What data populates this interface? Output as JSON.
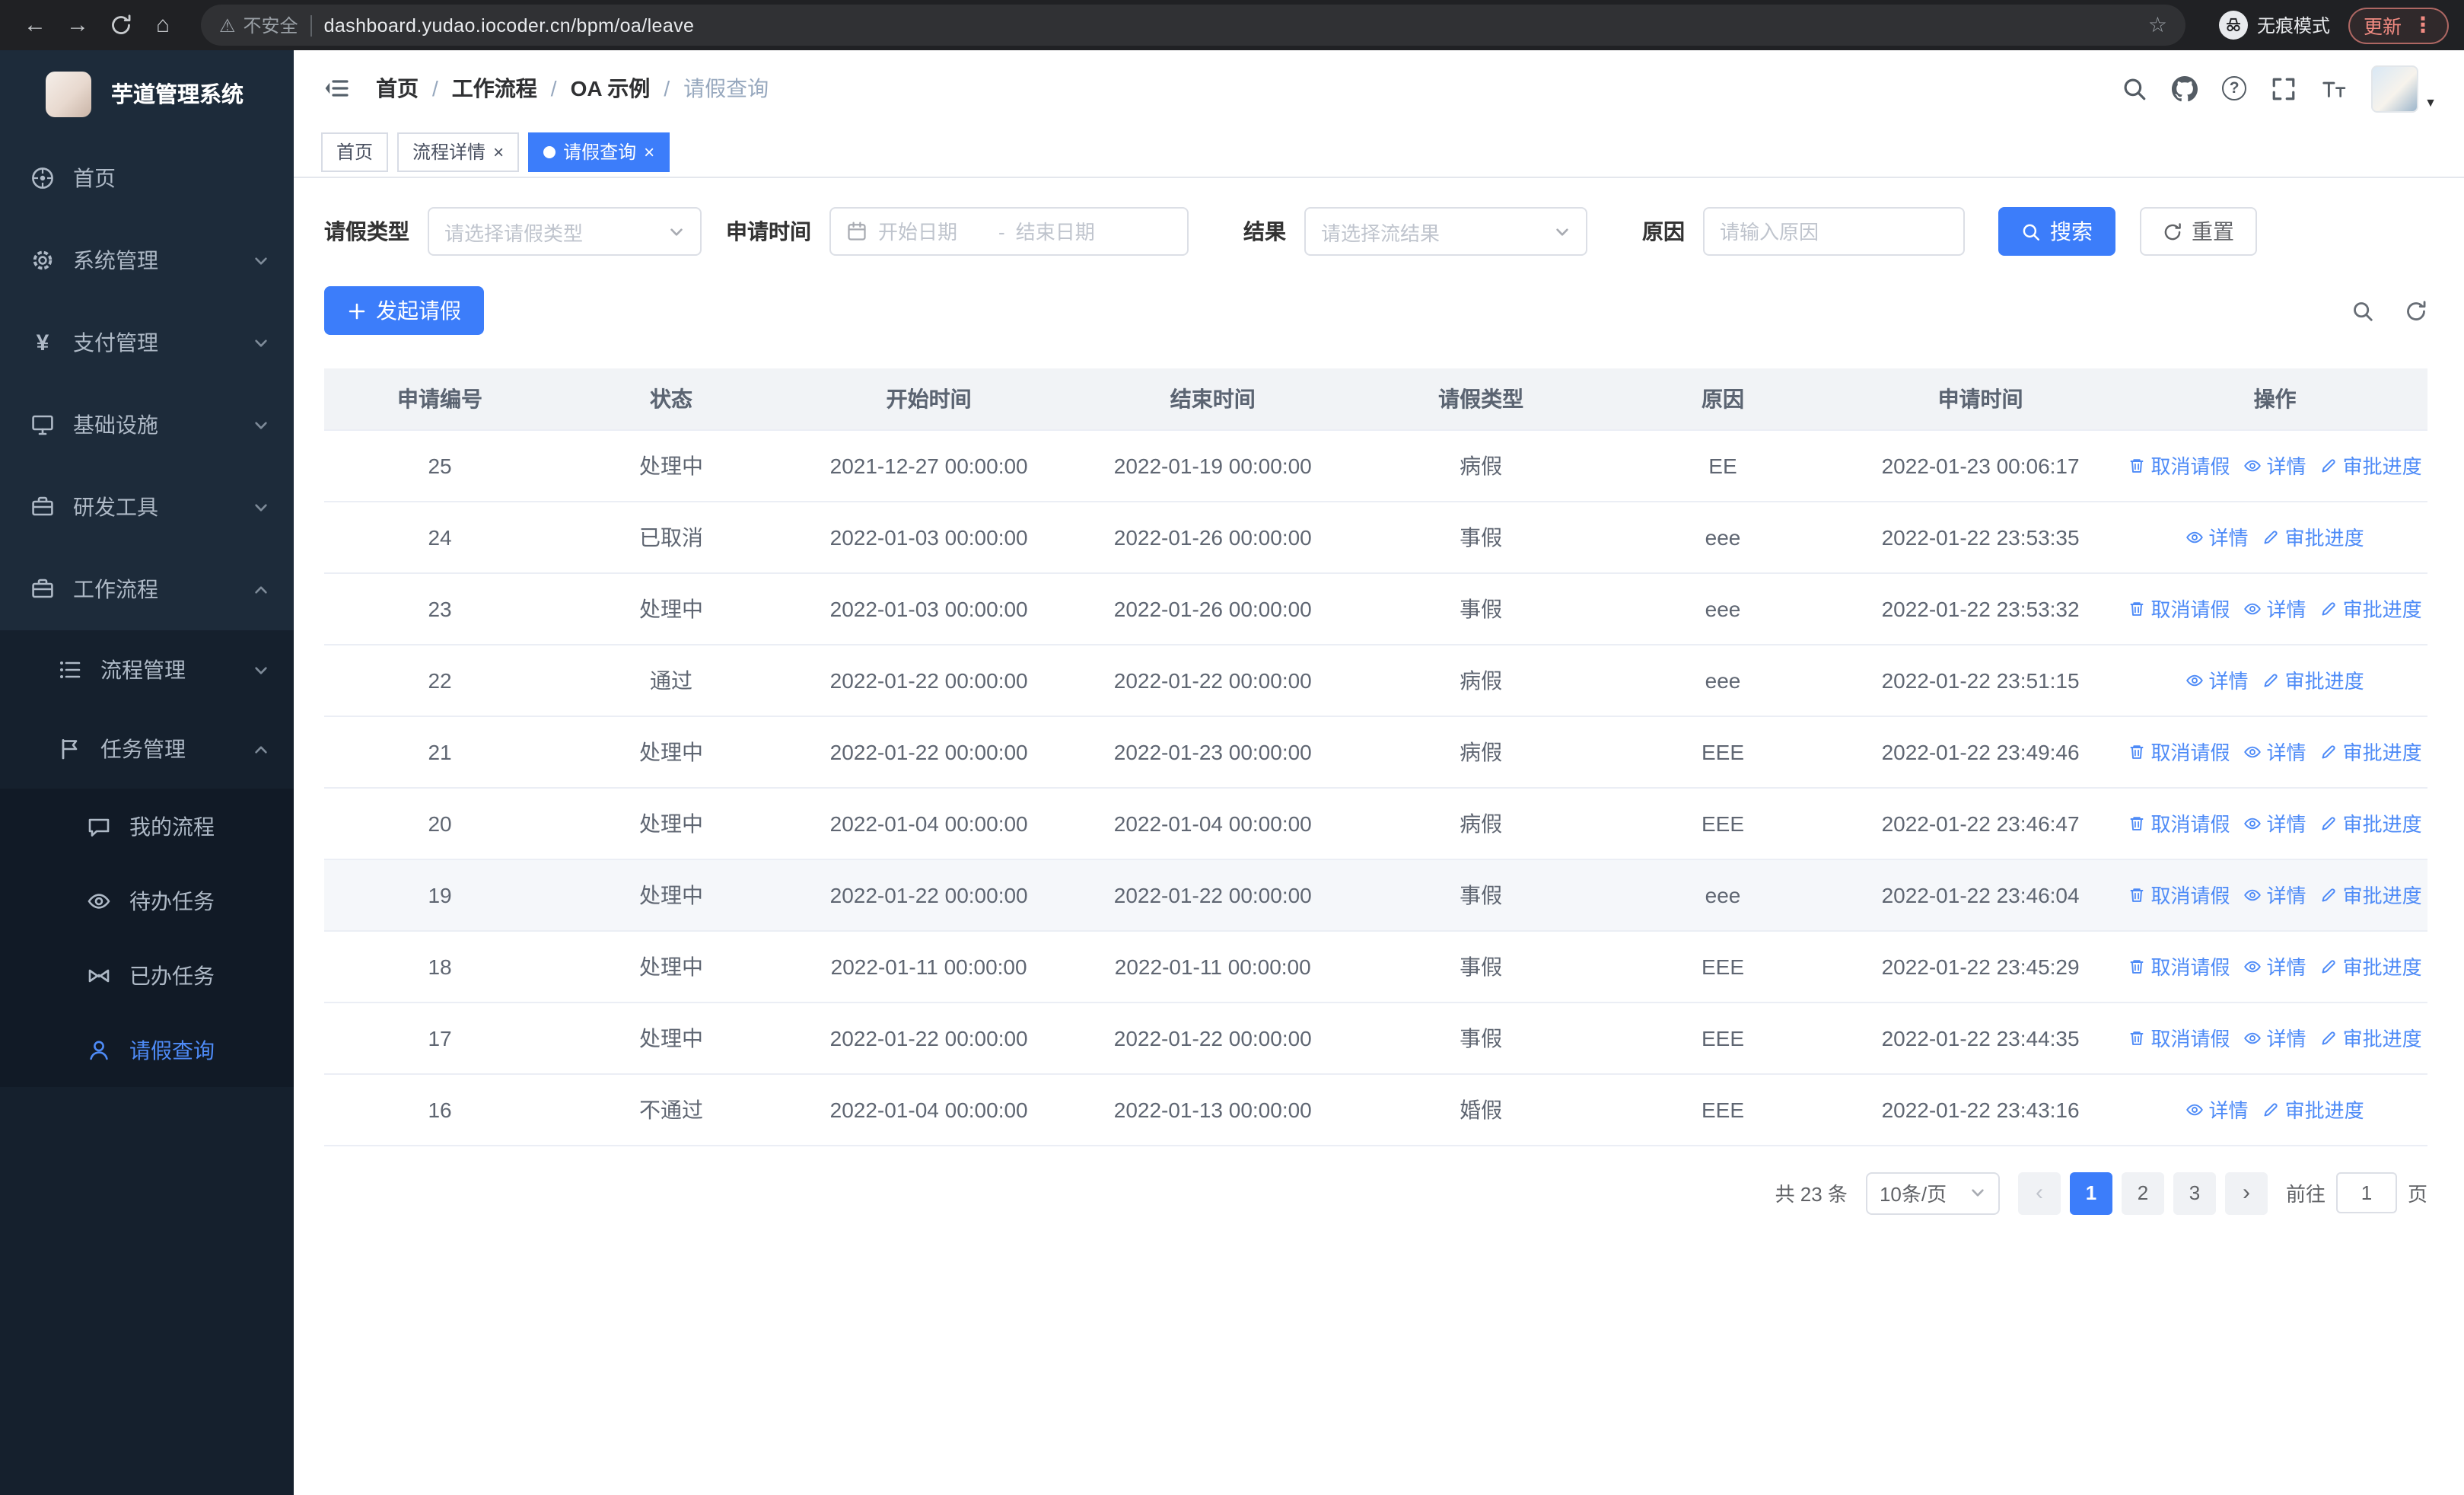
{
  "colors": {
    "accent": "#3c7dfa",
    "link": "#4e8bf7",
    "chrome_warn": "#f28b82",
    "sidebar_bg": "#1d2b3a",
    "sidebar_sub_bg": "#15202d",
    "sidebar_subsub_bg": "#111a26"
  },
  "icons": {
    "back": "←",
    "forward": "→",
    "home": "⌂",
    "warning": "⚠",
    "star": "☆",
    "more": "⋮",
    "close": "×",
    "caret_down": "▼",
    "breadcrumb_sep": "/",
    "question": "?",
    "prev": "‹",
    "next": "›"
  },
  "browser": {
    "security_label": "不安全",
    "url": "dashboard.yudao.iocoder.cn/bpm/oa/leave",
    "incognito_label": "无痕模式",
    "update_label": "更新"
  },
  "sidebar": {
    "logo_title": "芋道管理系统",
    "items": [
      {
        "label": "首页",
        "icon": "dashboard"
      },
      {
        "label": "系统管理",
        "icon": "settings-gear"
      },
      {
        "label": "支付管理",
        "icon": "yen"
      },
      {
        "label": "基础设施",
        "icon": "monitor"
      },
      {
        "label": "研发工具",
        "icon": "toolbox"
      },
      {
        "label": "工作流程",
        "icon": "briefcase"
      }
    ],
    "workflow_children": [
      {
        "label": "流程管理",
        "icon": "flow-list"
      },
      {
        "label": "任务管理",
        "icon": "flag"
      }
    ],
    "task_children": [
      {
        "label": "我的流程",
        "icon": "chat-bubble"
      },
      {
        "label": "待办任务",
        "icon": "eye"
      },
      {
        "label": "已办任务",
        "icon": "bowtie"
      },
      {
        "label": "请假查询",
        "icon": "user"
      }
    ]
  },
  "header": {
    "breadcrumbs": [
      "首页",
      "工作流程",
      "OA 示例",
      "请假查询"
    ]
  },
  "tabs": [
    {
      "label": "首页",
      "closable": false,
      "active": false
    },
    {
      "label": "流程详情",
      "closable": true,
      "active": false
    },
    {
      "label": "请假查询",
      "closable": true,
      "active": true
    }
  ],
  "filters": {
    "leave_type_label": "请假类型",
    "leave_type_placeholder": "请选择请假类型",
    "apply_time_label": "申请时间",
    "start_date_placeholder": "开始日期",
    "range_separator": "-",
    "end_date_placeholder": "结束日期",
    "result_label": "结果",
    "result_placeholder": "请选择流结果",
    "reason_label": "原因",
    "reason_placeholder": "请输入原因",
    "search_label": "搜索",
    "reset_label": "重置"
  },
  "toolbar": {
    "create_label": "发起请假"
  },
  "table": {
    "columns": [
      "申请编号",
      "状态",
      "开始时间",
      "结束时间",
      "请假类型",
      "原因",
      "申请时间",
      "操作"
    ],
    "action_labels": {
      "cancel": "取消请假",
      "detail": "详情",
      "progress": "审批进度"
    },
    "rows": [
      {
        "id": "25",
        "status": "处理中",
        "start": "2021-12-27 00:00:00",
        "end": "2022-01-19 00:00:00",
        "type": "病假",
        "reason": "EE",
        "applied": "2022-01-23 00:06:17",
        "cancellable": true,
        "hover": false
      },
      {
        "id": "24",
        "status": "已取消",
        "start": "2022-01-03 00:00:00",
        "end": "2022-01-26 00:00:00",
        "type": "事假",
        "reason": "eee",
        "applied": "2022-01-22 23:53:35",
        "cancellable": false,
        "hover": false
      },
      {
        "id": "23",
        "status": "处理中",
        "start": "2022-01-03 00:00:00",
        "end": "2022-01-26 00:00:00",
        "type": "事假",
        "reason": "eee",
        "applied": "2022-01-22 23:53:32",
        "cancellable": true,
        "hover": false
      },
      {
        "id": "22",
        "status": "通过",
        "start": "2022-01-22 00:00:00",
        "end": "2022-01-22 00:00:00",
        "type": "病假",
        "reason": "eee",
        "applied": "2022-01-22 23:51:15",
        "cancellable": false,
        "hover": false
      },
      {
        "id": "21",
        "status": "处理中",
        "start": "2022-01-22 00:00:00",
        "end": "2022-01-23 00:00:00",
        "type": "病假",
        "reason": "EEE",
        "applied": "2022-01-22 23:49:46",
        "cancellable": true,
        "hover": false
      },
      {
        "id": "20",
        "status": "处理中",
        "start": "2022-01-04 00:00:00",
        "end": "2022-01-04 00:00:00",
        "type": "病假",
        "reason": "EEE",
        "applied": "2022-01-22 23:46:47",
        "cancellable": true,
        "hover": false
      },
      {
        "id": "19",
        "status": "处理中",
        "start": "2022-01-22 00:00:00",
        "end": "2022-01-22 00:00:00",
        "type": "事假",
        "reason": "eee",
        "applied": "2022-01-22 23:46:04",
        "cancellable": true,
        "hover": true
      },
      {
        "id": "18",
        "status": "处理中",
        "start": "2022-01-11 00:00:00",
        "end": "2022-01-11 00:00:00",
        "type": "事假",
        "reason": "EEE",
        "applied": "2022-01-22 23:45:29",
        "cancellable": true,
        "hover": false
      },
      {
        "id": "17",
        "status": "处理中",
        "start": "2022-01-22 00:00:00",
        "end": "2022-01-22 00:00:00",
        "type": "事假",
        "reason": "EEE",
        "applied": "2022-01-22 23:44:35",
        "cancellable": true,
        "hover": false
      },
      {
        "id": "16",
        "status": "不通过",
        "start": "2022-01-04 00:00:00",
        "end": "2022-01-13 00:00:00",
        "type": "婚假",
        "reason": "EEE",
        "applied": "2022-01-22 23:43:16",
        "cancellable": false,
        "hover": false
      }
    ]
  },
  "pagination": {
    "total_text": "共 23 条",
    "page_size_text": "10条/页",
    "pages": [
      "1",
      "2",
      "3"
    ],
    "active_page": "1",
    "goto_label": "前往",
    "goto_value": "1",
    "page_suffix": "页"
  }
}
